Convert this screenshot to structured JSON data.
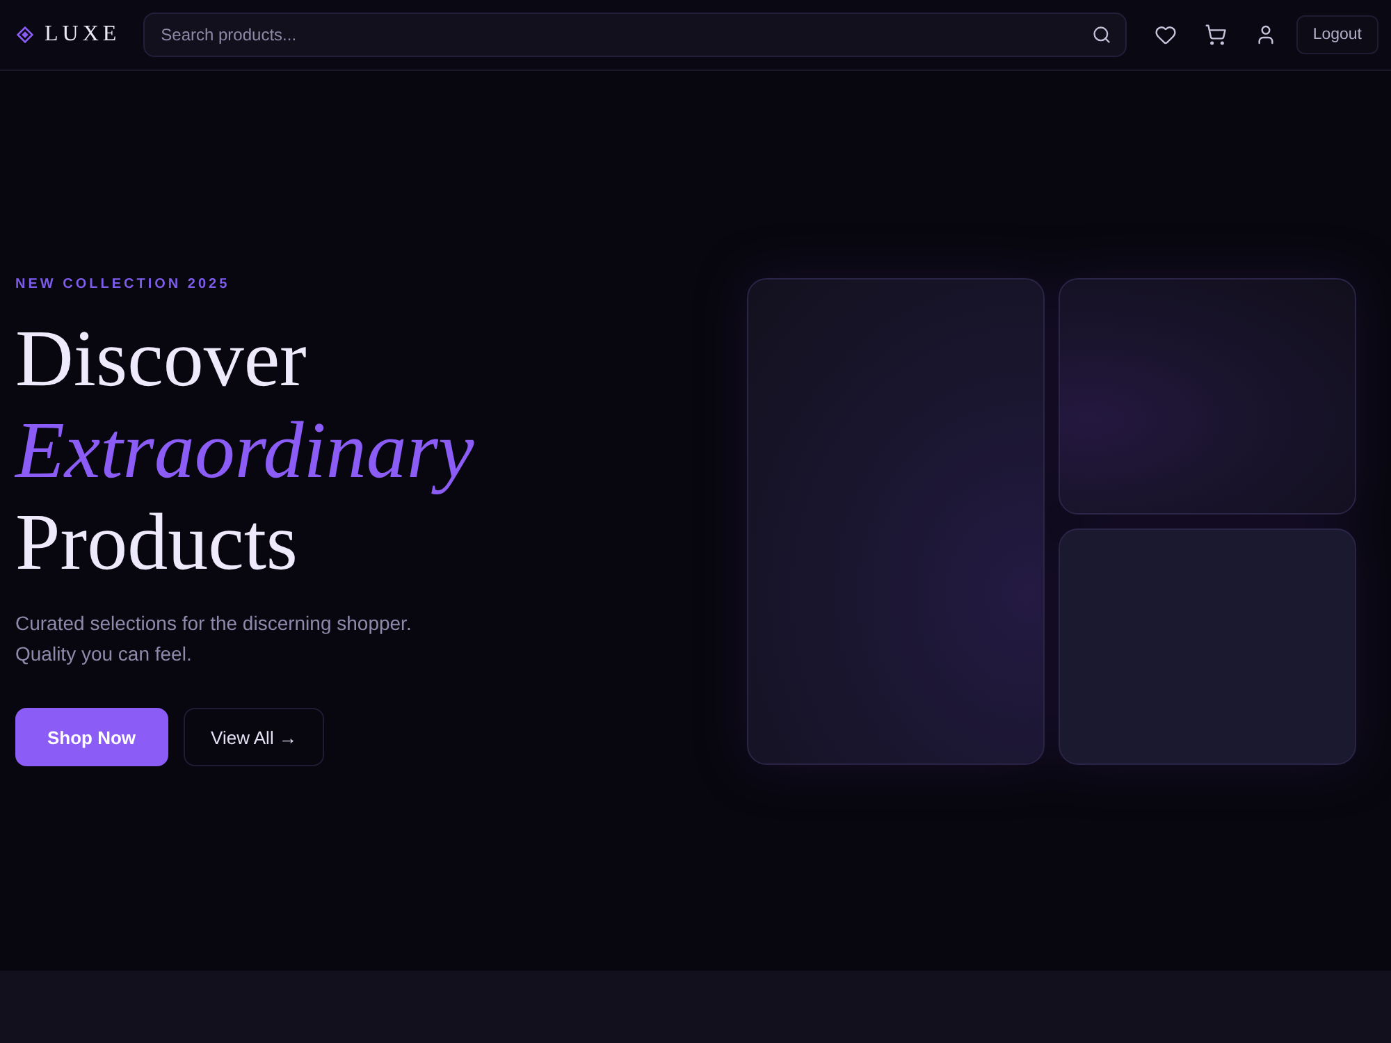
{
  "header": {
    "logo": "LUXE",
    "search": {
      "placeholder": "Search products..."
    },
    "logout": "Logout"
  },
  "hero": {
    "eyebrow": "NEW COLLECTION 2025",
    "title_lines": [
      {
        "text": "Discover",
        "kind": "plain"
      },
      {
        "text": "Extraordinary",
        "kind": "accent"
      },
      {
        "text": "Products",
        "kind": "plain"
      }
    ],
    "description": "Curated selections for the discerning shopper. Quality you can feel.",
    "buttons": [
      {
        "label": "Shop Now",
        "kind": "primary"
      },
      {
        "label": "View All →",
        "kind": "secondary"
      }
    ]
  }
}
